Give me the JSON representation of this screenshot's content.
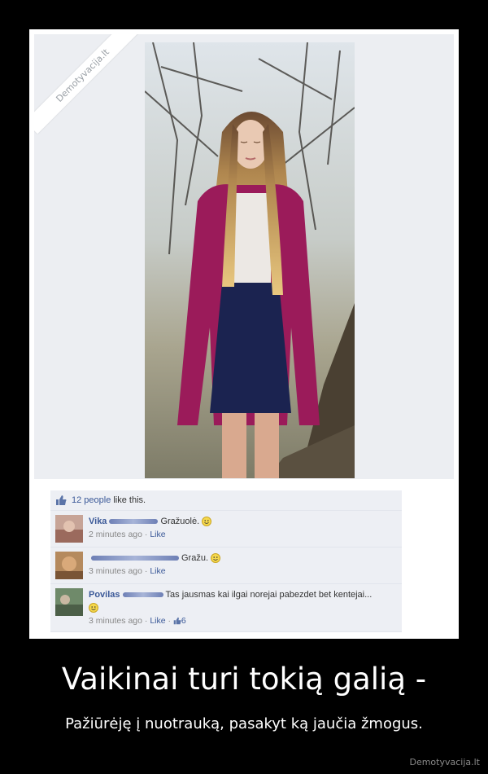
{
  "watermark": "Demotyvacija.lt",
  "likes": {
    "count_text": "12 people",
    "suffix": "like this."
  },
  "comments": [
    {
      "name": "Vika",
      "text": "Gražuolė.",
      "time": "2 minutes ago",
      "like": "Like"
    },
    {
      "name": "",
      "text": "Gražu.",
      "time": "3 minutes ago",
      "like": "Like"
    },
    {
      "name": "Povilas",
      "text": "Tas jausmas kai ilgai norejai pabezdet bet kentejai...",
      "time": "3 minutes ago",
      "like": "Like",
      "like_count": "6"
    }
  ],
  "caption": {
    "title": "Vaikinai turi tokią galią -",
    "subtitle": "Pažiūrėję į nuotrauką, pasakyt ką jaučia žmogus."
  },
  "site": "Demotyvacija.lt",
  "colors": {
    "fb_link": "#3b5998",
    "cardigan": "#9b1b5a",
    "skirt": "#1b2350"
  }
}
